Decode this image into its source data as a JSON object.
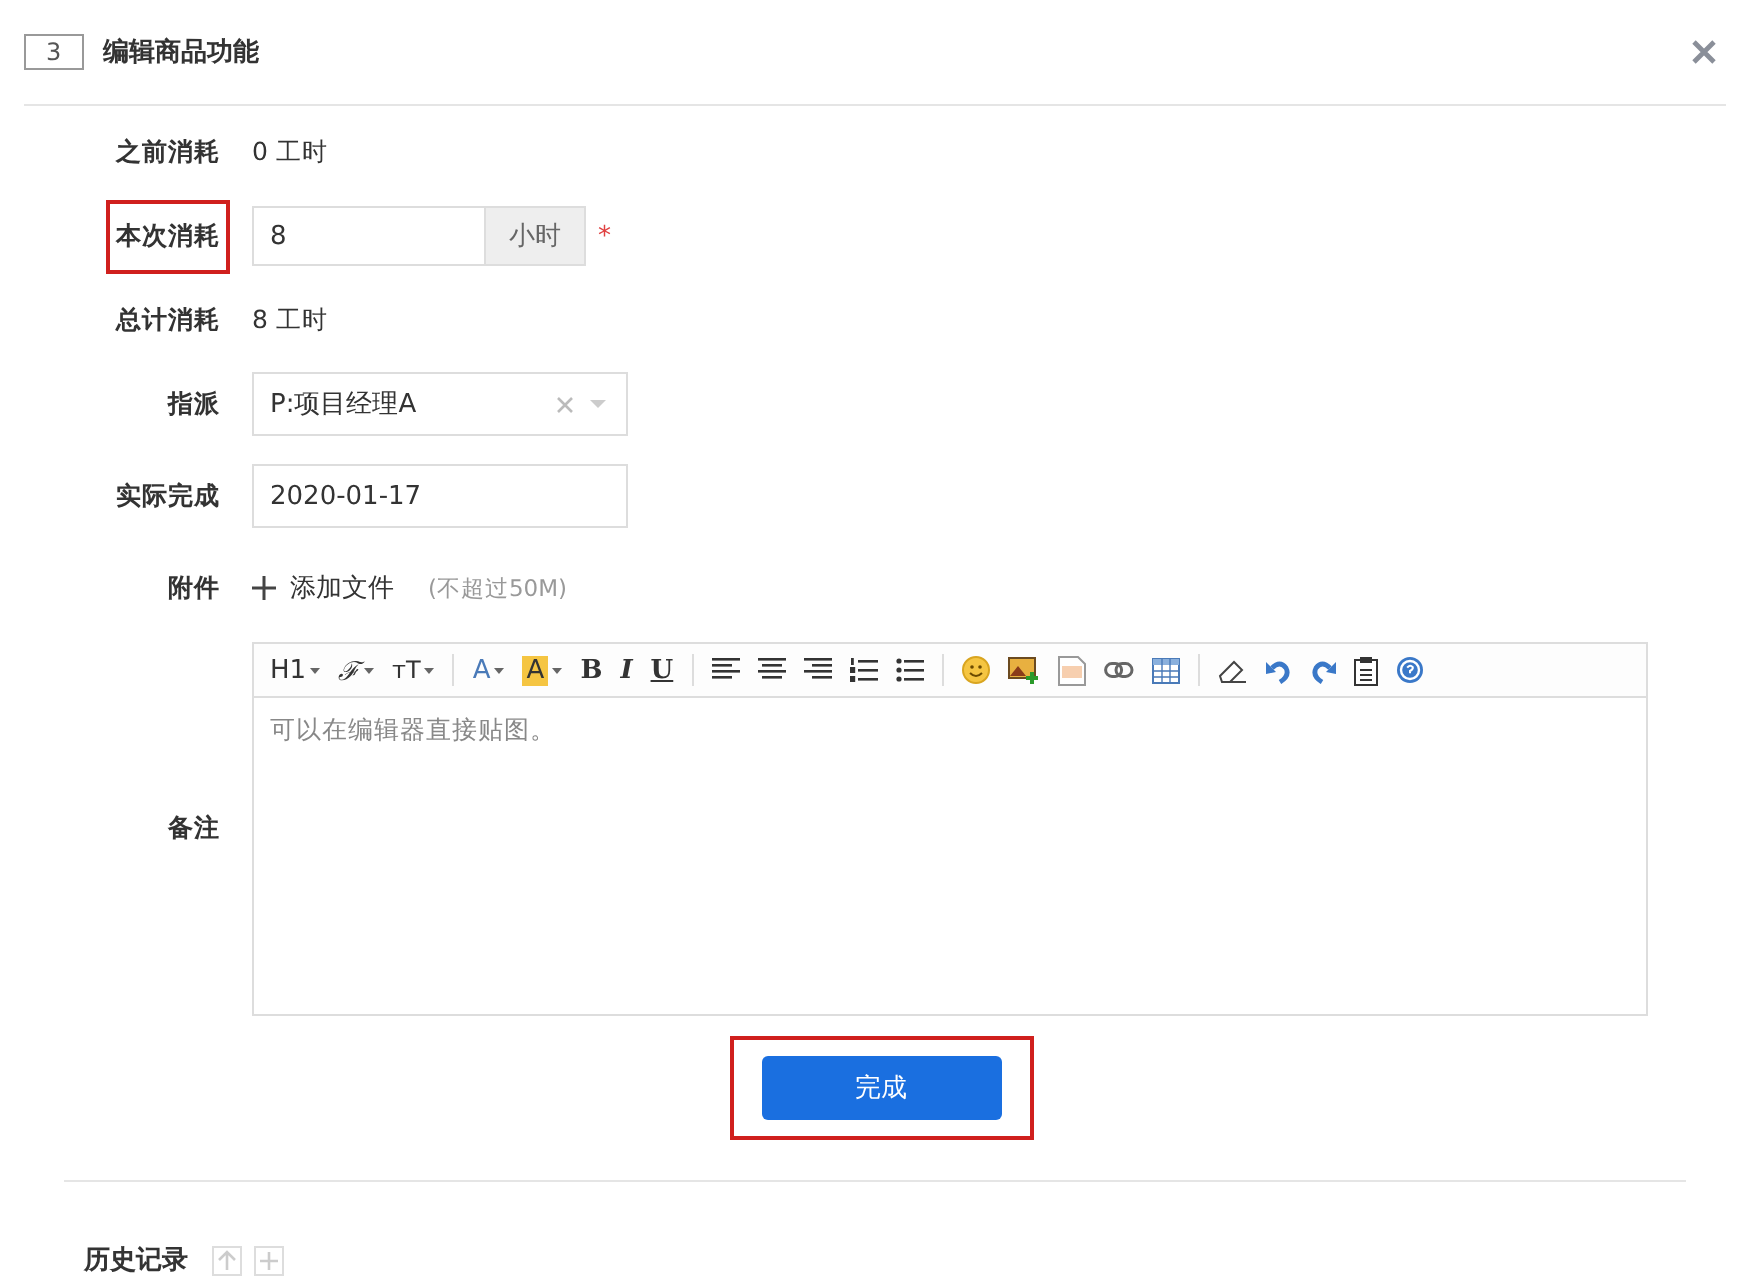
{
  "dialog": {
    "number": "3",
    "title": "编辑商品功能"
  },
  "fields": [
    {
      "kind": "text",
      "label": "之前消耗",
      "value": "0 工时",
      "highlighted": false
    },
    {
      "kind": "input",
      "label": "本次消耗",
      "value": "8",
      "addon": "小时",
      "required_mark": "*",
      "highlighted": true
    },
    {
      "kind": "text",
      "label": "总计消耗",
      "value": "8 工时",
      "highlighted": false
    },
    {
      "kind": "select",
      "label": "指派",
      "value": "P:项目经理A",
      "highlighted": false
    },
    {
      "kind": "date",
      "label": "实际完成",
      "value": "2020-01-17",
      "highlighted": false
    },
    {
      "kind": "upload",
      "label": "附件",
      "action": "添加文件",
      "hint": "(不超过50M)",
      "highlighted": false
    },
    {
      "kind": "editor",
      "label": "备注",
      "placeholder": "可以在编辑器直接贴图。",
      "toolbar_labels": [
        "H1",
        "ℱ",
        "тT",
        "A",
        "A",
        "B",
        "I",
        "U"
      ],
      "highlighted": false
    }
  ],
  "submit": {
    "label": "完成",
    "highlighted": true
  },
  "history": {
    "title": "历史记录"
  }
}
